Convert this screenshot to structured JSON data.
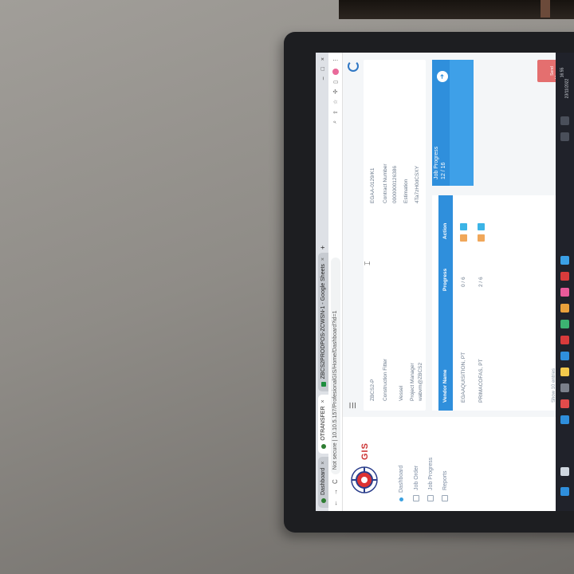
{
  "browser": {
    "tabs": [
      {
        "label": "Dashboard"
      },
      {
        "label": "OTRANSFER"
      },
      {
        "label": "ZBCS2PRODPOS-ZCWSN-1 - Google Sheets"
      }
    ],
    "new_tab": "+",
    "window_controls": [
      "–",
      "□",
      "×"
    ],
    "url": "Not secure | 10.10.5.157/ProfesionalGIS/Home/Dashboard?id=1",
    "nav": {
      "back": "←",
      "forward": "→",
      "reload": "C"
    }
  },
  "sidebar": {
    "brand": "GIS",
    "items": [
      {
        "label": "Dashboard"
      },
      {
        "label": "Job Order"
      },
      {
        "label": "Job Progress"
      },
      {
        "label": "Reports"
      }
    ]
  },
  "info": {
    "row1": [
      "ZBCS2-P",
      "EGAA-0129/K1"
    ],
    "row2": [
      "Construction Fitter",
      "Contract Number",
      "0000000126386"
    ],
    "row3": [
      "Vessel",
      "Estimation"
    ],
    "row4": [
      "Project Manager",
      "wabvm@ZBCS2",
      "4Ta7zH0dCSXY"
    ]
  },
  "table": {
    "headers": {
      "vendor": "Vendor Name",
      "progress": "Progress",
      "action": "Action"
    },
    "rows": [
      {
        "vendor": "EGAAQUISITION, PT",
        "progress": "0 / 6"
      },
      {
        "vendor": "PRIMACOFAS, PT",
        "progress": "2 / 6"
      }
    ],
    "pager": "Show  10  entries"
  },
  "job_progress": {
    "title": "Job Progress",
    "value": "12 / 16"
  },
  "chat": {
    "label": "Send Message"
  },
  "taskbar": {
    "time": "16:55",
    "date": "23/11/2022"
  },
  "colors": {
    "accent": "#2f8fdc",
    "brand": "#cc3333",
    "orange_action": "#f0a75a",
    "cyan_action": "#3cb4e6"
  }
}
